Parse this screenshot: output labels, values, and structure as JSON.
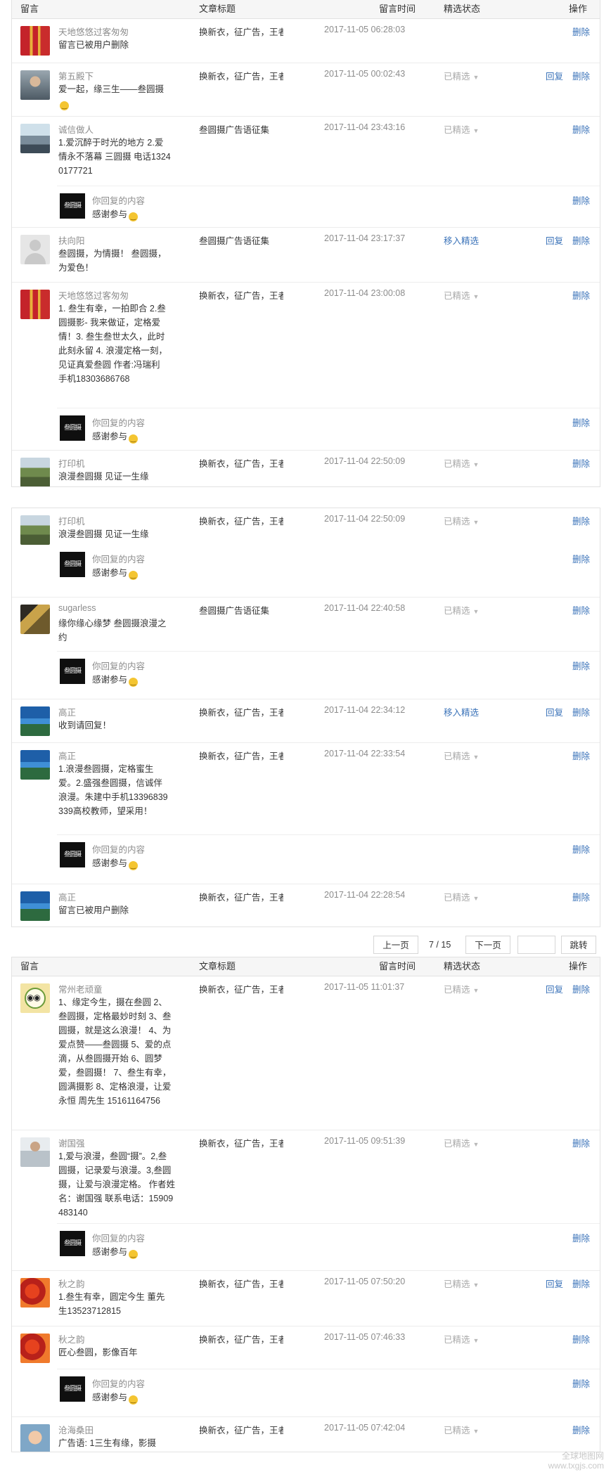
{
  "header": {
    "msg": "留言",
    "title": "文章标题",
    "time": "留言时间",
    "status": "精选状态",
    "op": "操作"
  },
  "actions": {
    "delete": "删除",
    "reply": "回复",
    "featured": "已精选",
    "move": "移入精选"
  },
  "reply_common": {
    "label": "你回复的内容",
    "text": "感谢参与",
    "logo": "叁圆摄"
  },
  "panel1": [
    {
      "name": "天地悠悠过客匆匆",
      "msg": "留言已被用户删除",
      "title": "换新衣，征广告，王者在...",
      "time": "2017-11-05 06:28:03"
    },
    {
      "name": "第五殿下",
      "msg": "爱一起，缘三生——叁圆摄",
      "title": "换新衣，征广告，王者在...",
      "time": "2017-11-05 00:02:43",
      "status": "已精选"
    },
    {
      "name": "诚信做人",
      "msg": "1.爱沉醉于时光的地方 2.爱情永不落幕 三圆摄 电话13240177721",
      "title": "叁圆摄广告语征集",
      "time": "2017-11-04 23:43:16",
      "status": "已精选"
    },
    {
      "name": "扶向阳",
      "msg": "叁圆摄，为情摄！ 叁圆摄，为爱色！",
      "title": "叁圆摄广告语征集",
      "time": "2017-11-04 23:17:37",
      "status": "移入精选"
    },
    {
      "name": "天地悠悠过客匆匆",
      "msg": "1. 叁生有幸，一拍即合 2.叁圆摄影- 我来做证，定格爱情！3. 叁生叁世太久，此时此刻永留 4. 浪漫定格一刻，见证真爱叁圆 作者:冯瑞利 手机18303686768",
      "title": "换新衣，征广告，王者在...",
      "time": "2017-11-04 23:00:08",
      "status": "已精选"
    },
    {
      "name": "打印机",
      "msg": "浪漫叁圆摄 见证一生缘",
      "title": "换新衣，征广告，王者在...",
      "time": "2017-11-04 22:50:09",
      "status": "已精选"
    }
  ],
  "panel2": [
    {
      "name": "打印机",
      "msg": "浪漫叁圆摄 见证一生缘",
      "title": "换新衣，征广告，王者在...",
      "time": "2017-11-04 22:50:09",
      "status": "已精选"
    },
    {
      "name": "sugarless",
      "msg": "缘你缘心缘梦 叁圆摄浪漫之约",
      "title": "叁圆摄广告语征集",
      "time": "2017-11-04 22:40:58",
      "status": "已精选"
    },
    {
      "name": "高正",
      "msg": "收到请回复！",
      "title": "换新衣，征广告，王者在...",
      "time": "2017-11-04 22:34:12",
      "status": "移入精选"
    },
    {
      "name": "高正",
      "msg": "1.浪漫叁圆摄，定格蜜生爱。2.盛强叁圆摄，信诚伴浪漫。朱建中手机13396839339高校教师，望采用！",
      "title": "换新衣，征广告，王者在...",
      "time": "2017-11-04 22:33:54",
      "status": "已精选"
    },
    {
      "name": "高正",
      "msg": "留言已被用户删除",
      "title": "换新衣，征广告，王者在...",
      "time": "2017-11-04 22:28:54",
      "status": "已精选"
    }
  ],
  "pager": {
    "prev": "上一页",
    "info": "7 / 15",
    "next": "下一页",
    "jump": "跳转"
  },
  "panel3": [
    {
      "name": "常州老顽童",
      "msg": "1、缘定今生，摄在叁圆 2、叁圆摄，定格最妙时刻 3、叁圆摄，就是这么浪漫！ 4、为爱点赞——叁圆摄 5、爱的点滴，从叁圆摄开始 6、圆梦爱，叁圆摄！ 7、叁生有幸，圆满摄影 8、定格浪漫，让爱永恒 周先生 15161164756",
      "title": "换新衣，征广告，王者在...",
      "time": "2017-11-05 11:01:37",
      "status": "已精选"
    },
    {
      "name": "谢国强",
      "msg": "1,爱与浪漫，叁圆“摄”。2,叁圆摄，记录爱与浪漫。3,叁圆摄，让爱与浪漫定格。 作者姓名：谢国强 联系电话：15909483140",
      "title": "换新衣，征广告，王者在...",
      "time": "2017-11-05 09:51:39",
      "status": "已精选"
    },
    {
      "name": "秋之韵",
      "msg": "1.叁生有幸，圆定今生 董先生13523712815",
      "title": "换新衣，征广告，王者在...",
      "time": "2017-11-05 07:50:20",
      "status": "已精选"
    },
    {
      "name": "秋之韵",
      "msg": "匠心叁圆，影像百年",
      "title": "换新衣，征广告，王者在...",
      "time": "2017-11-05 07:46:33",
      "status": "已精选"
    },
    {
      "name": "沧海桑田",
      "msg": "广告语: 1三生有缘，影摄",
      "title": "换新衣，征广告，王者在...",
      "time": "2017-11-05 07:42:04",
      "status": "已精选"
    }
  ],
  "watermark": "全球地图网\nwww.txgjs.com"
}
